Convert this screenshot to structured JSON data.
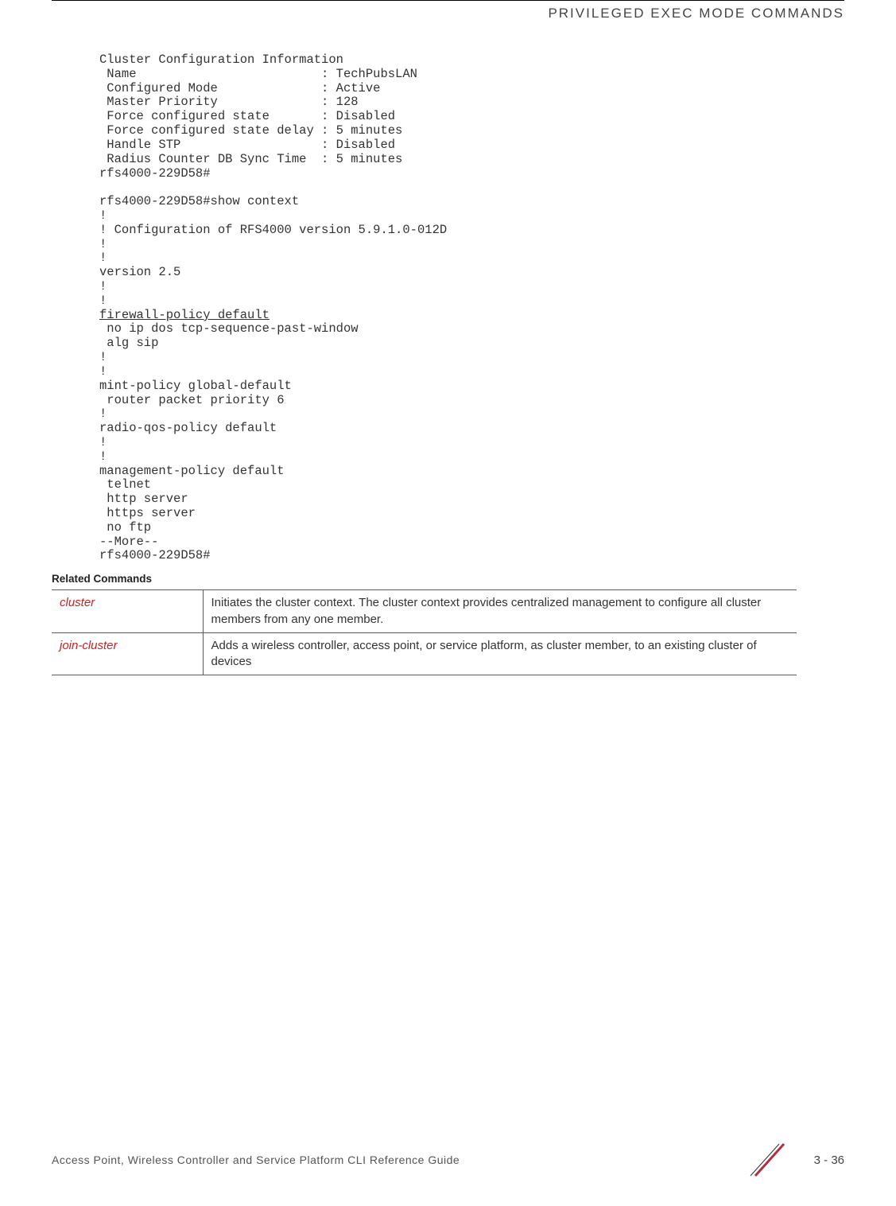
{
  "header": {
    "section_title": "PRIVILEGED EXEC MODE COMMANDS"
  },
  "terminal": {
    "block1": "Cluster Configuration Information\n Name                         : TechPubsLAN\n Configured Mode              : Active\n Master Priority              : 128\n Force configured state       : Disabled\n Force configured state delay : 5 minutes\n Handle STP                   : Disabled\n Radius Counter DB Sync Time  : 5 minutes\nrfs4000-229D58#",
    "block2": "rfs4000-229D58#show context\n!\n! Configuration of RFS4000 version 5.9.1.0-012D\n!\n!\nversion 2.5\n!\n!\n",
    "firewall_link": "firewall-policy default",
    "block3": "\n no ip dos tcp-sequence-past-window\n alg sip\n!\n!\nmint-policy global-default\n router packet priority 6\n!\nradio-qos-policy default\n!\n!\nmanagement-policy default\n telnet\n http server\n https server\n no ftp\n--More--\nrfs4000-229D58#"
  },
  "related": {
    "heading": "Related Commands",
    "rows": [
      {
        "cmd": "cluster",
        "desc": "Initiates the cluster context. The cluster context provides centralized management to configure all cluster members from any one member."
      },
      {
        "cmd": "join-cluster",
        "desc": "Adds a wireless controller, access point, or service platform, as cluster member, to an existing cluster of devices"
      }
    ]
  },
  "footer": {
    "guide": "Access Point, Wireless Controller and Service Platform CLI Reference Guide",
    "page": "3 - 36"
  }
}
